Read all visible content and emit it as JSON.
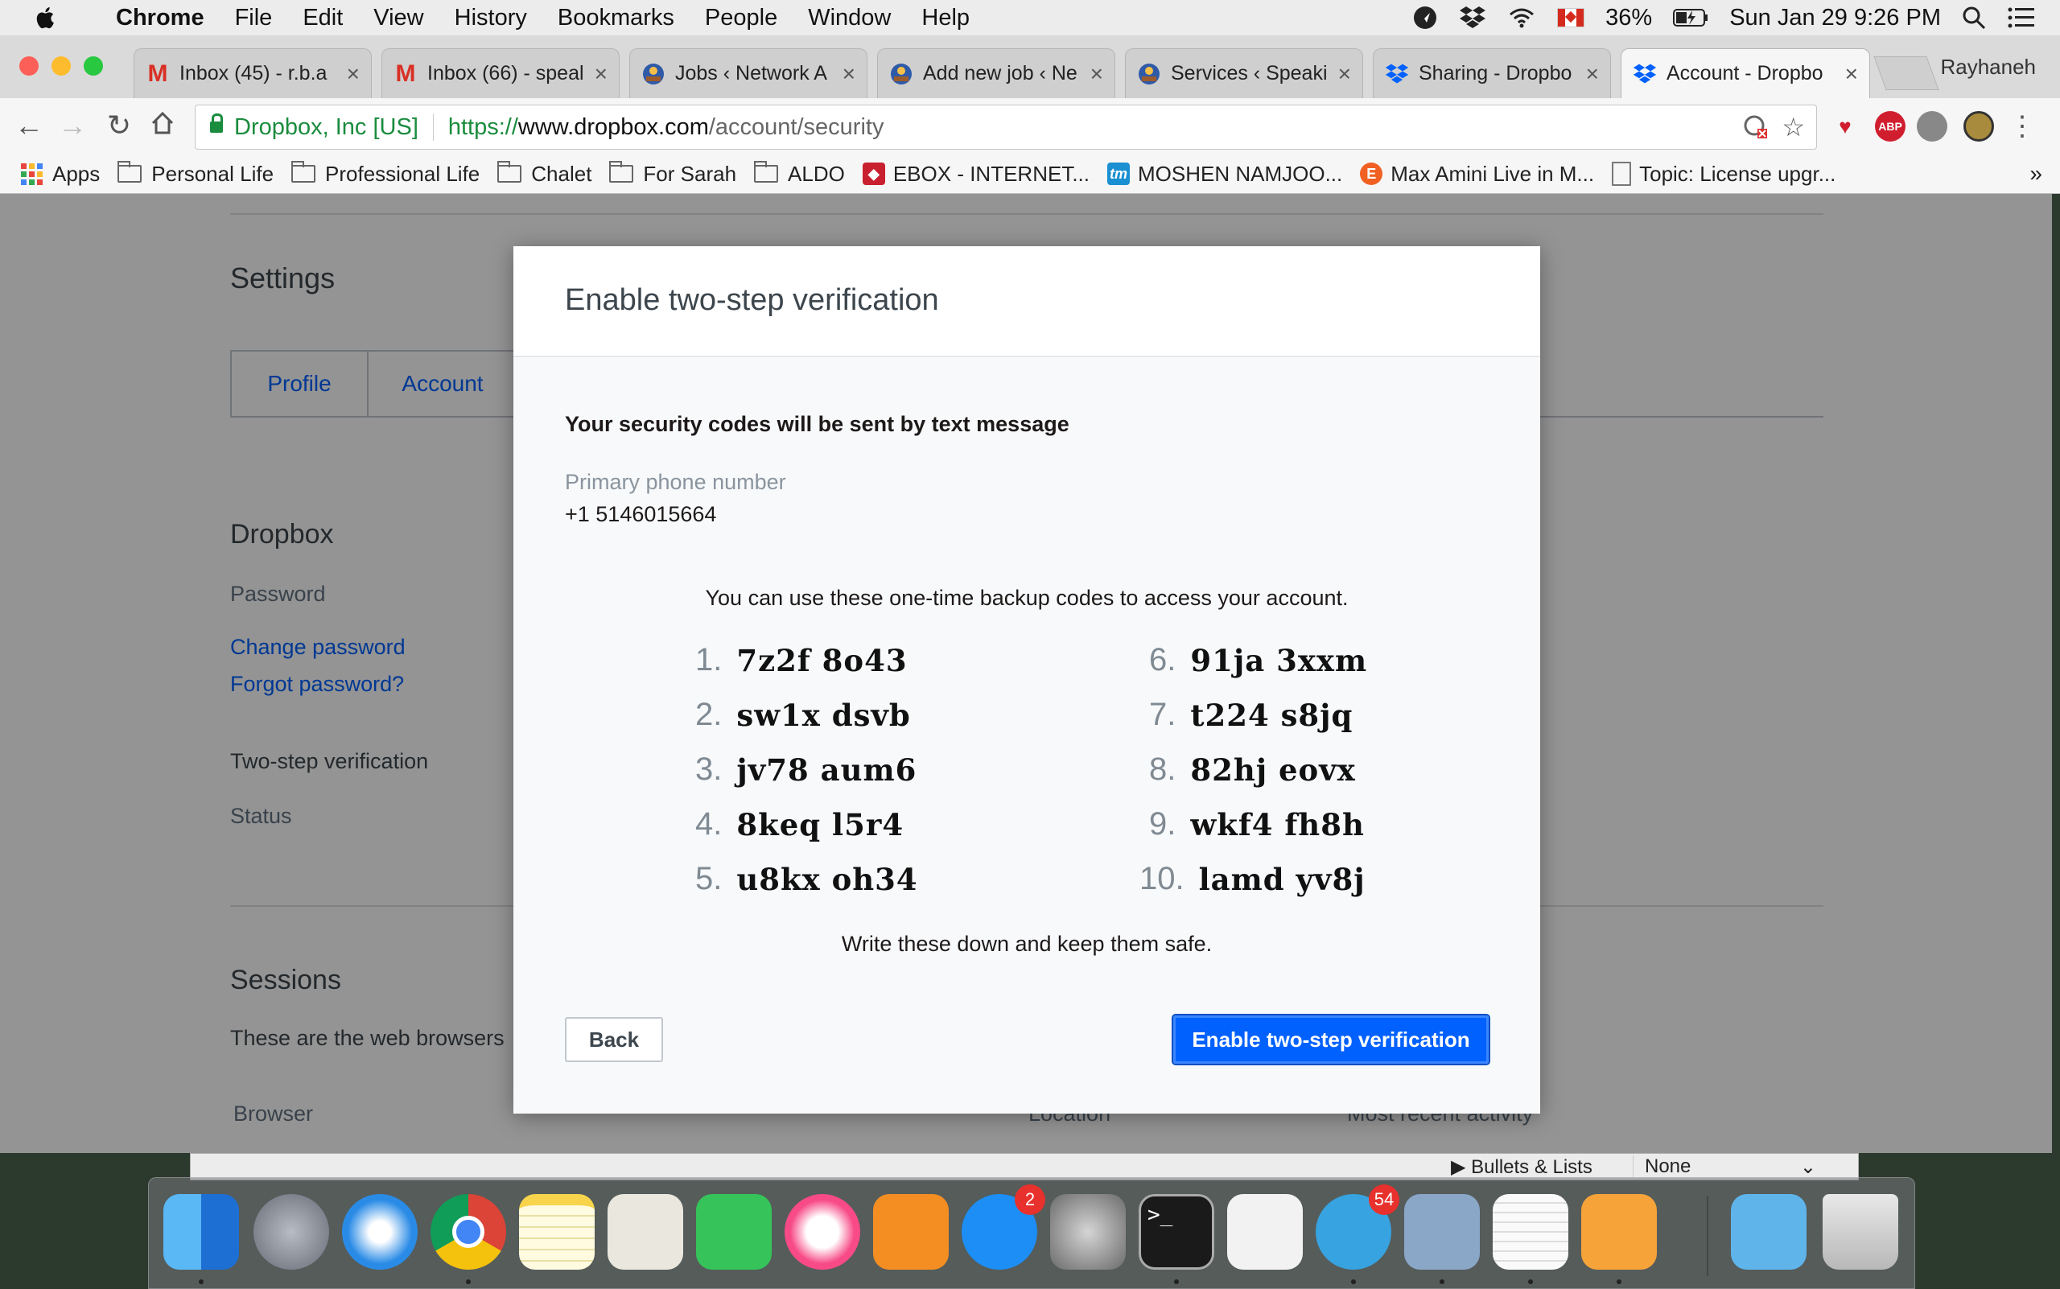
{
  "menubar": {
    "app": "Chrome",
    "items": [
      "File",
      "Edit",
      "View",
      "History",
      "Bookmarks",
      "People",
      "Window",
      "Help"
    ],
    "battery": "36%",
    "clock": "Sun Jan 29  9:26 PM"
  },
  "tabs": [
    {
      "title": "Inbox (45) - r.b.a",
      "icon": "gmail-icon"
    },
    {
      "title": "Inbox (66) - speal",
      "icon": "gmail-icon"
    },
    {
      "title": "Jobs ‹ Network A",
      "icon": "wordpress-icon"
    },
    {
      "title": "Add new job ‹ Ne",
      "icon": "wordpress-icon"
    },
    {
      "title": "Services ‹ Speaki",
      "icon": "wordpress-icon"
    },
    {
      "title": "Sharing - Dropbo",
      "icon": "dropbox-icon"
    },
    {
      "title": "Account - Dropbo",
      "icon": "dropbox-icon",
      "active": true
    }
  ],
  "profile_name": "Rayhaneh",
  "address": {
    "site_identity": "Dropbox, Inc [US]",
    "scheme": "https://",
    "host": "www.dropbox.com",
    "path": "/account/security"
  },
  "bookmarks": [
    {
      "label": "Apps",
      "type": "apps"
    },
    {
      "label": "Personal Life",
      "type": "folder"
    },
    {
      "label": "Professional Life",
      "type": "folder"
    },
    {
      "label": "Chalet",
      "type": "folder"
    },
    {
      "label": "For Sarah",
      "type": "folder"
    },
    {
      "label": "ALDO",
      "type": "folder"
    },
    {
      "label": "EBOX - INTERNET...",
      "type": "site",
      "color": "#c8202f",
      "glyph": "◆"
    },
    {
      "label": "MOSHEN NAMJOO...",
      "type": "site",
      "color": "#1a8fd1",
      "glyph": "tm"
    },
    {
      "label": "Max Amini Live in M...",
      "type": "site",
      "color": "#f06022",
      "glyph": "E"
    },
    {
      "label": "Topic: License upgr...",
      "type": "page"
    }
  ],
  "settings": {
    "title": "Settings",
    "tabs": [
      "Profile",
      "Account"
    ],
    "dropbox_heading": "Dropbox",
    "password_label": "Password",
    "change_password": "Change password",
    "forgot_password": "Forgot password?",
    "two_step_label": "Two-step verification",
    "status_label": "Status",
    "sessions_heading": "Sessions",
    "sessions_text": "These are the web browsers",
    "col_browser": "Browser",
    "col_location": "Location",
    "col_activity": "Most recent activity"
  },
  "modal": {
    "title": "Enable two-step verification",
    "codes_heading": "Your security codes will be sent by text message",
    "phone_label": "Primary phone number",
    "phone_value": "+1 5146015664",
    "intro": "You can use these one-time backup codes to access your account.",
    "codes": [
      {
        "n": "1.",
        "code": "7z2f 8o43"
      },
      {
        "n": "2.",
        "code": "sw1x dsvb"
      },
      {
        "n": "3.",
        "code": "jv78 aum6"
      },
      {
        "n": "4.",
        "code": "8keq l5r4"
      },
      {
        "n": "5.",
        "code": "u8kx oh34"
      },
      {
        "n": "6.",
        "code": "91ja 3xxm"
      },
      {
        "n": "7.",
        "code": "t224 s8jq"
      },
      {
        "n": "8.",
        "code": "82hj eovx"
      },
      {
        "n": "9.",
        "code": "wkf4 fh8h"
      },
      {
        "n": "10.",
        "code": "lamd yv8j"
      }
    ],
    "note": "Write these down and keep them safe.",
    "back_label": "Back",
    "enable_label": "Enable two-step verification"
  },
  "lower_strip": {
    "label": "Bullets & Lists",
    "select_value": "None"
  },
  "dock": {
    "badges": {
      "appstore": "2",
      "telegram": "54"
    }
  }
}
